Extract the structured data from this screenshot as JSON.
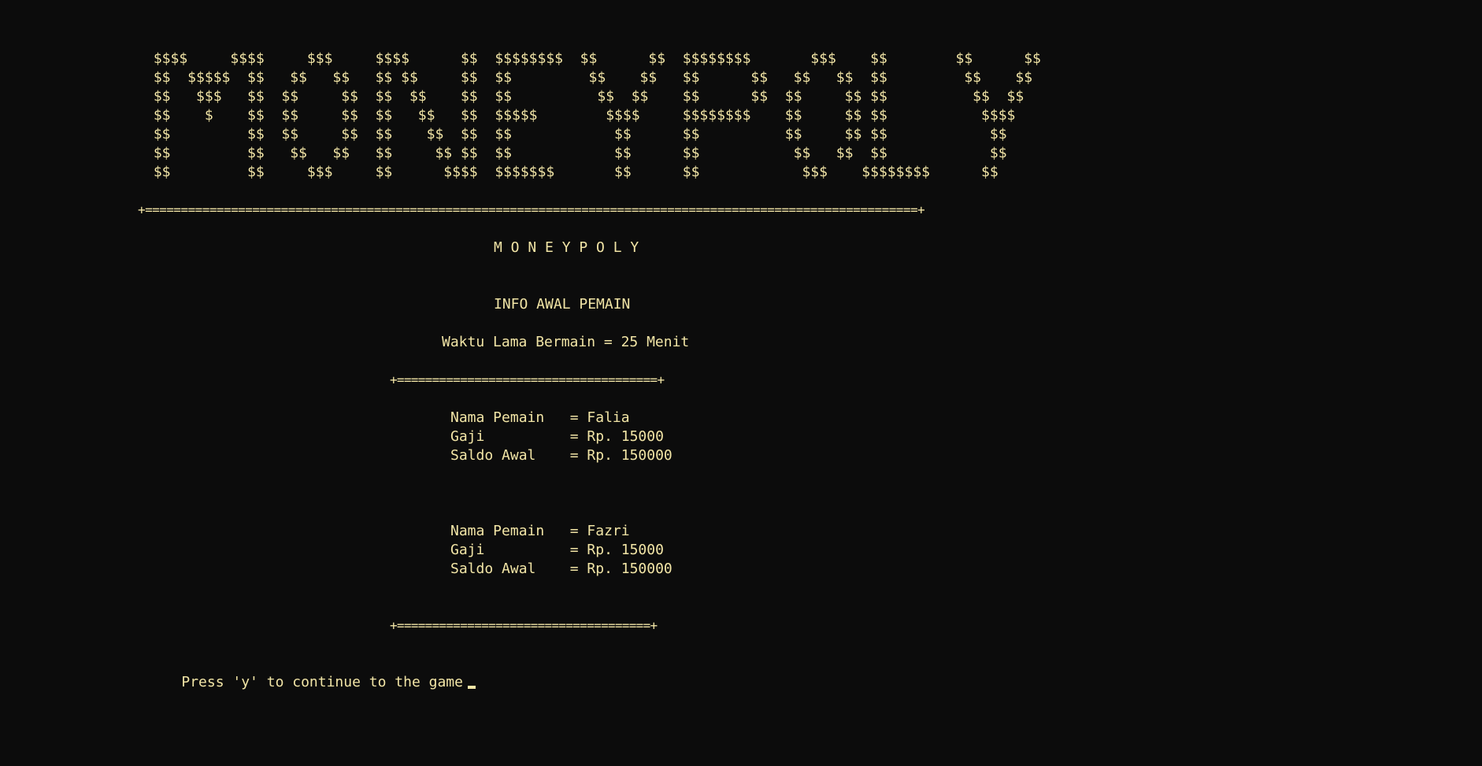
{
  "banner": [
    " $$$$     $$$$     $$$     $$$$      $$  $$$$$$$$  $$      $$  $$$$$$$$       $$$    $$        $$      $$",
    " $$  $$$$$  $$   $$   $$   $$ $$     $$  $$         $$    $$   $$      $$   $$   $$  $$         $$    $$",
    " $$   $$$   $$  $$     $$  $$  $$    $$  $$          $$  $$    $$      $$  $$     $$ $$          $$  $$",
    " $$    $    $$  $$     $$  $$   $$   $$  $$$$$        $$$$     $$$$$$$$    $$     $$ $$           $$$$",
    " $$         $$  $$     $$  $$    $$  $$  $$            $$      $$          $$     $$ $$            $$",
    " $$         $$   $$   $$   $$     $$ $$  $$            $$      $$           $$   $$  $$            $$",
    " $$         $$     $$$     $$      $$$$  $$$$$$$       $$      $$            $$$    $$$$$$$$      $$"
  ],
  "top_border": "+============================================================================================================+",
  "title": "M O N E Y P O L Y",
  "section_heading": "INFO AWAL PEMAIN",
  "play_time": "Waktu Lama Bermain = 25 Menit",
  "box_top": "+=====================================+",
  "players": [
    {
      "name_line": "Nama Pemain   = Falia",
      "salary_line": "Gaji          = Rp. 15000",
      "balance_line": "Saldo Awal    = Rp. 150000"
    },
    {
      "name_line": "Nama Pemain   = Fazri",
      "salary_line": "Gaji          = Rp. 15000",
      "balance_line": "Saldo Awal    = Rp. 150000"
    }
  ],
  "box_bottom": "+====================================+",
  "prompt": "Press 'y' to continue to the game"
}
